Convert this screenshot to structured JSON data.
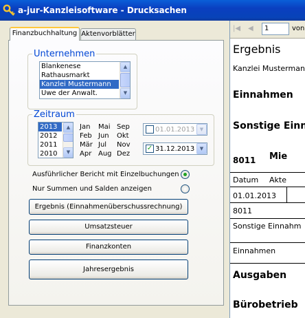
{
  "window": {
    "title": "a-jur-Kanzleisoftware - Drucksachen",
    "icon": "key-icon"
  },
  "tabs": [
    {
      "label": "Finanzbuchhaltung",
      "active": true
    },
    {
      "label": "Aktenvorblätter",
      "active": false
    }
  ],
  "unternehmen": {
    "legend": "Unternehmen",
    "items": [
      "Blankenese",
      "Rathausmarkt",
      "Kanzlei Mustermann",
      "Uwe der Anwalt."
    ],
    "selected": "Kanzlei Mustermann"
  },
  "zeitraum": {
    "legend": "Zeitraum",
    "years": [
      "2013",
      "2012",
      "2011",
      "2010"
    ],
    "selected_year": "2013",
    "months": [
      "Jan",
      "Mai",
      "Sep",
      "Feb",
      "Jun",
      "Okt",
      "Mär",
      "Jul",
      "Nov",
      "Apr",
      "Aug",
      "Dez"
    ],
    "date_from": {
      "value": "01.01.2013",
      "checked": false
    },
    "date_to": {
      "value": "31.12.2013",
      "checked": true
    }
  },
  "options": {
    "detailed": "Ausführlicher Bericht mit Einzelbuchungen",
    "summary": "Nur Summen und Salden anzeigen",
    "selected": "detailed"
  },
  "buttons": {
    "ergebnis": "Ergebnis (Einnahmenüberschussrechnung)",
    "umsatzsteuer": "Umsatzsteuer",
    "finanzkonten": "Finanzkonten",
    "jahresergebnis": "Jahresergebnis"
  },
  "report": {
    "page_value": "1",
    "page_of": "von",
    "title": "Ergebnis",
    "company": "Kanzlei Musterman",
    "einnahmen_header": "Einnahmen",
    "sonstige_header": "Sonstige Einn",
    "account_no": "8011",
    "account_label": "Mie",
    "col_datum": "Datum",
    "col_akte": "Akte",
    "row_date": "01.01.2013",
    "row_account": "8011",
    "sonstige_row": "Sonstige Einnahm",
    "einnahmen_row": "Einnahmen",
    "ausgaben_header": "Ausgaben",
    "buero_header": "Bürobetrieb"
  }
}
